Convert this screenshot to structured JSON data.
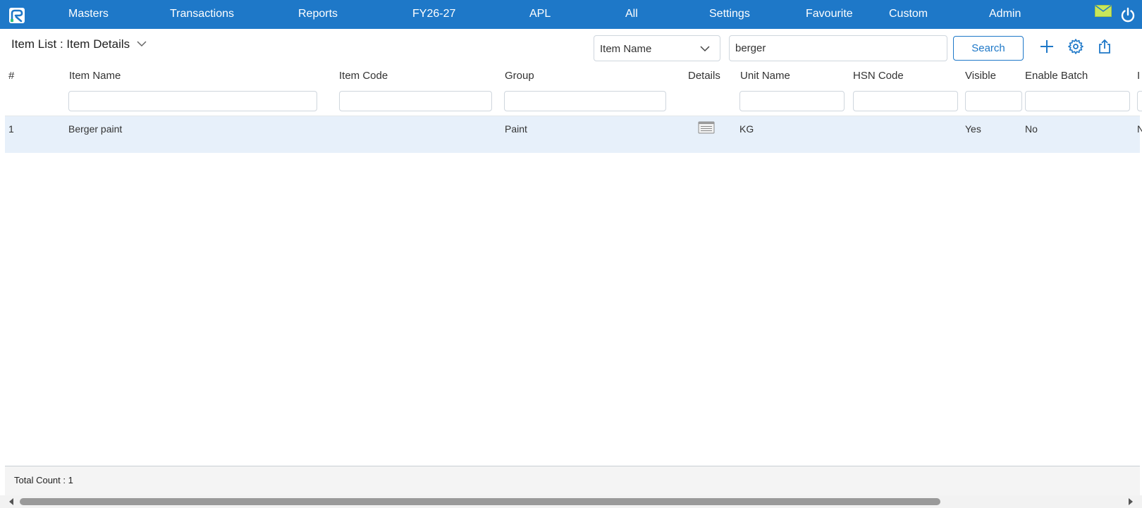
{
  "nav": {
    "items": [
      "Masters",
      "Transactions",
      "Reports",
      "FY26-27",
      "APL",
      "All",
      "Settings",
      "Favourite",
      "Custom",
      "Admin"
    ]
  },
  "page": {
    "title": "Item List : Item Details"
  },
  "search": {
    "field_selected": "Item Name",
    "value": "berger",
    "button_label": "Search"
  },
  "table": {
    "columns": [
      "#",
      "Item Name",
      "Item Code",
      "Group",
      "Details",
      "Unit Name",
      "HSN Code",
      "Visible",
      "Enable Batch",
      "I"
    ],
    "rows": [
      {
        "index": "1",
        "item_name": "Berger paint",
        "item_code": "",
        "group": "Paint",
        "unit_name": "KG",
        "hsn_code": "",
        "visible": "Yes",
        "enable_batch": "No",
        "clipped": "N"
      }
    ]
  },
  "footer": {
    "total_count": "Total Count : 1"
  },
  "colors": {
    "nav_bg": "#1e78c8",
    "row_selected_bg": "#e7f0fa",
    "accent": "#1e78c8"
  },
  "icons": [
    "logo-icon",
    "mail-icon",
    "power-icon",
    "chevron-down-icon",
    "plus-icon",
    "gear-icon",
    "export-icon",
    "details-icon"
  ]
}
